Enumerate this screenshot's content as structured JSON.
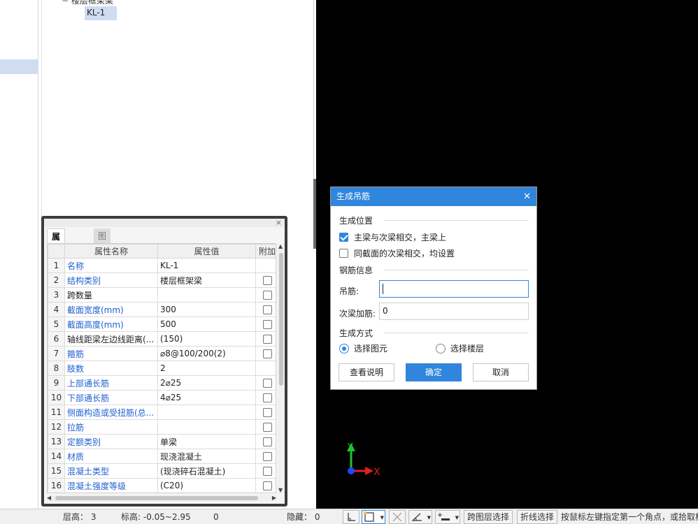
{
  "tree": {
    "parent_label": "楼层框架梁",
    "child_label": "KL-1"
  },
  "prop_panel": {
    "close_icon": "×",
    "tabs": [
      "属性列表",
      "图层管理"
    ],
    "columns": [
      "属性名称",
      "属性值",
      "附加"
    ],
    "rows": [
      {
        "n": "1",
        "name": "名称",
        "value": "KL-1",
        "blue": true,
        "chk": false
      },
      {
        "n": "2",
        "name": "结构类别",
        "value": "楼层框架梁",
        "blue": true,
        "chk": true
      },
      {
        "n": "3",
        "name": "跨数量",
        "value": "",
        "blue": false,
        "chk": true
      },
      {
        "n": "4",
        "name": "截面宽度(mm)",
        "value": "300",
        "blue": true,
        "chk": true
      },
      {
        "n": "5",
        "name": "截面高度(mm)",
        "value": "500",
        "blue": true,
        "chk": true
      },
      {
        "n": "6",
        "name": "轴线距梁左边线距离(...",
        "value": "(150)",
        "blue": false,
        "chk": true
      },
      {
        "n": "7",
        "name": "箍筋",
        "value": "⌀8@100/200(2)",
        "blue": true,
        "chk": true
      },
      {
        "n": "8",
        "name": "肢数",
        "value": "2",
        "blue": true,
        "chk": false
      },
      {
        "n": "9",
        "name": "上部通长筋",
        "value": "2⌀25",
        "blue": true,
        "chk": true
      },
      {
        "n": "10",
        "name": "下部通长筋",
        "value": "4⌀25",
        "blue": true,
        "chk": true
      },
      {
        "n": "11",
        "name": "侧面构造或受扭筋(总...",
        "value": "",
        "blue": true,
        "chk": true
      },
      {
        "n": "12",
        "name": "拉筋",
        "value": "",
        "blue": true,
        "chk": true
      },
      {
        "n": "13",
        "name": "定额类别",
        "value": "单梁",
        "blue": true,
        "chk": true
      },
      {
        "n": "14",
        "name": "材质",
        "value": "现浇混凝土",
        "blue": true,
        "chk": true
      },
      {
        "n": "15",
        "name": "混凝土类型",
        "value": "(现浇碎石混凝土)",
        "blue": true,
        "chk": true
      },
      {
        "n": "16",
        "name": "混凝土强度等级",
        "value": "(C20)",
        "blue": true,
        "chk": true
      }
    ]
  },
  "canvas": {
    "axis_y": "Y",
    "axis_x": "X",
    "axis_y_color": "#22c22a",
    "axis_x_color": "#e02020"
  },
  "dialog": {
    "title": "生成吊筋",
    "close_icon": "✕",
    "position_section": "生成位置",
    "opt_main_secondary": "主梁与次梁相交，主梁上",
    "opt_main_secondary_checked": true,
    "opt_same_section": "同截面的次梁相交，均设置",
    "opt_same_section_checked": false,
    "rebar_section": "钢筋信息",
    "hanger_label": "吊筋:",
    "hanger_value": "",
    "secondary_label": "次梁加筋:",
    "secondary_value": "0",
    "method_section": "生成方式",
    "radio_select_element": "选择图元",
    "radio_select_floor": "选择楼层",
    "selected_method": "选择图元",
    "btn_help": "查看说明",
    "btn_ok": "确定",
    "btn_cancel": "取消",
    "accent": "#2f86dc"
  },
  "status": {
    "floor_height": "层高：  3",
    "elevation": "标高: -0.05~2.95",
    "zero": "0",
    "hidden": "隐藏：  0",
    "cross_layer": "跨图层选择",
    "polyline": "折线选择",
    "hint": "按鼠标左键指定第一个角点，或拾取构"
  }
}
